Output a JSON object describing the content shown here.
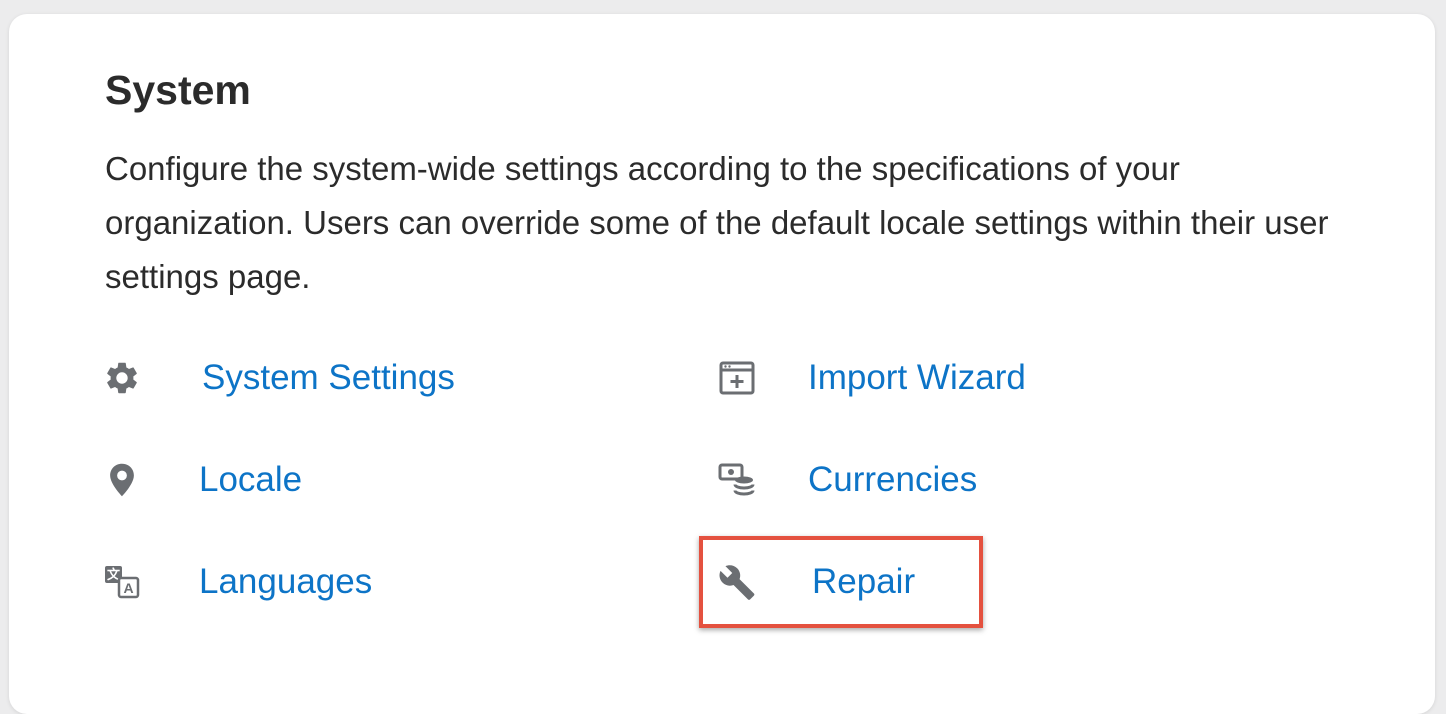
{
  "section": {
    "title": "System",
    "description": "Configure the system-wide settings according to the specifications of your organization. Users can override some of the default locale settings within their user settings page."
  },
  "links": {
    "system_settings": {
      "label": "System Settings",
      "icon": "gear-icon"
    },
    "import_wizard": {
      "label": "Import Wizard",
      "icon": "import-window-icon"
    },
    "locale": {
      "label": "Locale",
      "icon": "map-pin-icon"
    },
    "currencies": {
      "label": "Currencies",
      "icon": "currency-coins-icon"
    },
    "languages": {
      "label": "Languages",
      "icon": "translate-icon"
    },
    "repair": {
      "label": "Repair",
      "icon": "wrench-icon"
    }
  },
  "colors": {
    "link": "#0d74c7",
    "icon": "#6b6e72",
    "highlight_border": "#e4513f",
    "text": "#2b2b2b"
  }
}
